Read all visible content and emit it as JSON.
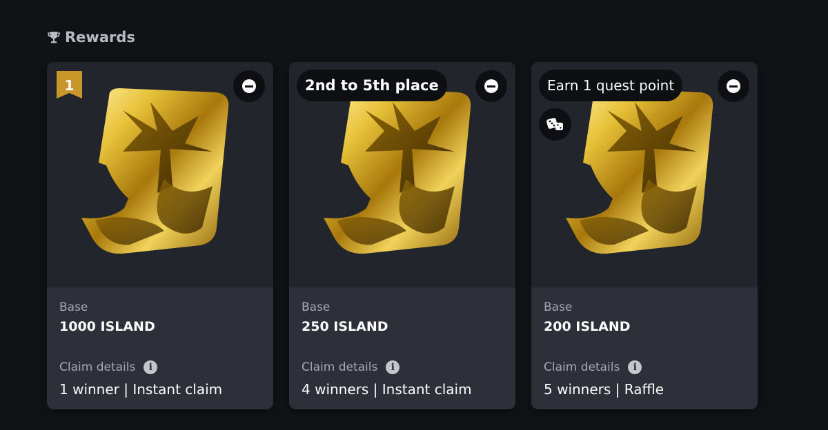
{
  "section": {
    "title": "Rewards",
    "icon": "trophy-icon"
  },
  "cards": [
    {
      "badge": "1",
      "pill": "",
      "base_label": "Base",
      "amount": "1000 ISLAND",
      "claim_label": "Claim details",
      "claim_value": "1 winner | Instant claim"
    },
    {
      "badge": "",
      "pill": "2nd to 5th place",
      "base_label": "Base",
      "amount": "250 ISLAND",
      "claim_label": "Claim details",
      "claim_value": "4 winners | Instant claim"
    },
    {
      "badge": "",
      "pill": "Earn 1 quest point",
      "base_label": "Base",
      "amount": "200 ISLAND",
      "claim_label": "Claim details",
      "claim_value": "5 winners | Raffle"
    }
  ],
  "colors": {
    "background": "#111216",
    "card_top": "#23252c",
    "card_bottom": "#2d3039",
    "gold": "#d4a92a"
  }
}
